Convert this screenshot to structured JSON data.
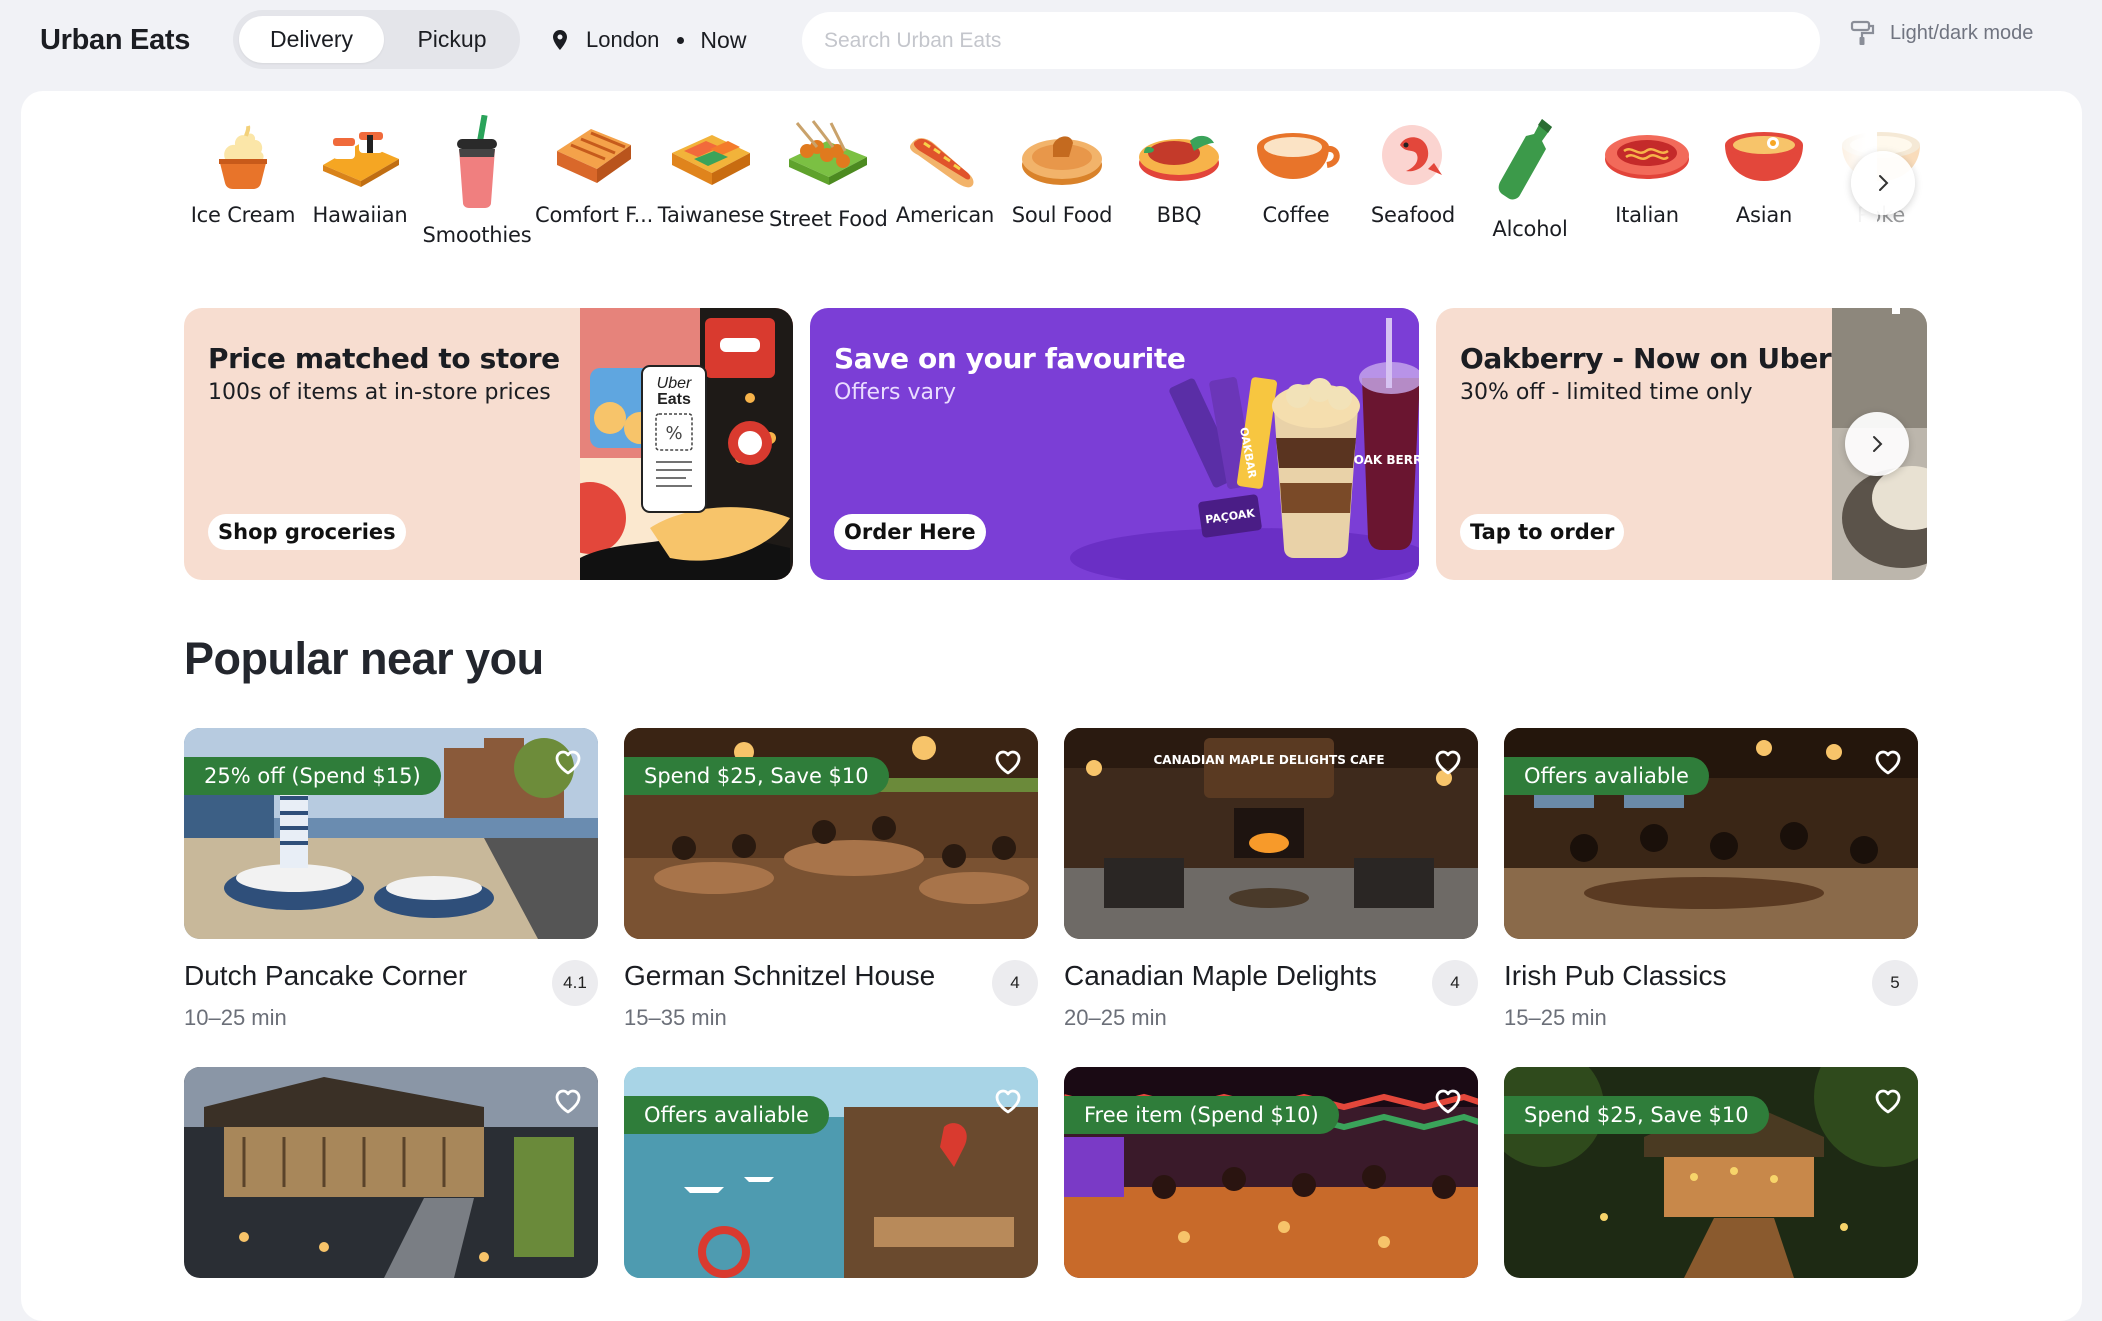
{
  "header": {
    "brand": "Urban Eats",
    "modes": {
      "active": "Delivery",
      "inactive": "Pickup"
    },
    "location": "London",
    "time": "Now",
    "search_placeholder": "Search Urban Eats",
    "theme_toggle": "Light/dark mode"
  },
  "categories": [
    {
      "label": "Ice Cream",
      "icon": "ice-cream-icon"
    },
    {
      "label": "Hawaiian",
      "icon": "sushi-icon"
    },
    {
      "label": "Smoothies",
      "icon": "smoothie-icon"
    },
    {
      "label": "Comfort F...",
      "icon": "comfort-food-icon"
    },
    {
      "label": "Taiwanese",
      "icon": "bento-icon"
    },
    {
      "label": "Street Food",
      "icon": "skewers-icon"
    },
    {
      "label": "American",
      "icon": "hot-dog-icon"
    },
    {
      "label": "Soul Food",
      "icon": "pie-icon"
    },
    {
      "label": "BBQ",
      "icon": "bbq-icon"
    },
    {
      "label": "Coffee",
      "icon": "coffee-icon"
    },
    {
      "label": "Seafood",
      "icon": "shrimp-icon"
    },
    {
      "label": "Alcohol",
      "icon": "bottle-icon"
    },
    {
      "label": "Italian",
      "icon": "pasta-icon"
    },
    {
      "label": "Asian",
      "icon": "noodle-bowl-icon"
    },
    {
      "label": "Poke",
      "icon": "poke-bowl-icon"
    }
  ],
  "promos": [
    {
      "title": "Price matched to store",
      "subtitle": "100s of items at in-store prices",
      "cta": "Shop groceries",
      "bg": "#f7ddd0"
    },
    {
      "title": "Save on your favourite",
      "subtitle": "Offers vary",
      "cta": "Order Here",
      "bg": "#7b3ed6"
    },
    {
      "title": "Oakberry - Now on Uber",
      "subtitle": "30% off - limited time only",
      "cta": "Tap to order",
      "bg": "#f7ddd0"
    }
  ],
  "promo_art": {
    "grocery_badge_line1": "Uber",
    "grocery_badge_line2": "Eats",
    "bar_label": "OAKBAR",
    "cup_label": "OAK BERRY",
    "pack_label": "PAÇOAK"
  },
  "section_title": "Popular near you",
  "restaurants": [
    {
      "name": "Dutch Pancake Corner",
      "time": "10–25 min",
      "rating": "4.1",
      "offer": "25% off (Spend $15)"
    },
    {
      "name": "German Schnitzel House",
      "time": "15–35 min",
      "rating": "4",
      "offer": "Spend $25, Save $10"
    },
    {
      "name": "Canadian Maple Delights",
      "time": "20–25 min",
      "rating": "4",
      "offer": "",
      "sign": "CANADIAN MAPLE DELIGHTS CAFE"
    },
    {
      "name": "Irish Pub Classics",
      "time": "15–25 min",
      "rating": "5",
      "offer": "Offers avaliable"
    },
    {
      "name": "",
      "time": "",
      "rating": "",
      "offer": ""
    },
    {
      "name": "",
      "time": "",
      "rating": "",
      "offer": "Offers avaliable"
    },
    {
      "name": "",
      "time": "",
      "rating": "",
      "offer": "Free item (Spend $10)"
    },
    {
      "name": "",
      "time": "",
      "rating": "",
      "offer": "Spend $25, Save $10"
    }
  ],
  "colors": {
    "offer_badge": "#2f7d3a",
    "promo_peach": "#f7ddd0",
    "promo_purple": "#7b3ed6",
    "background": "#f1f2f6"
  }
}
